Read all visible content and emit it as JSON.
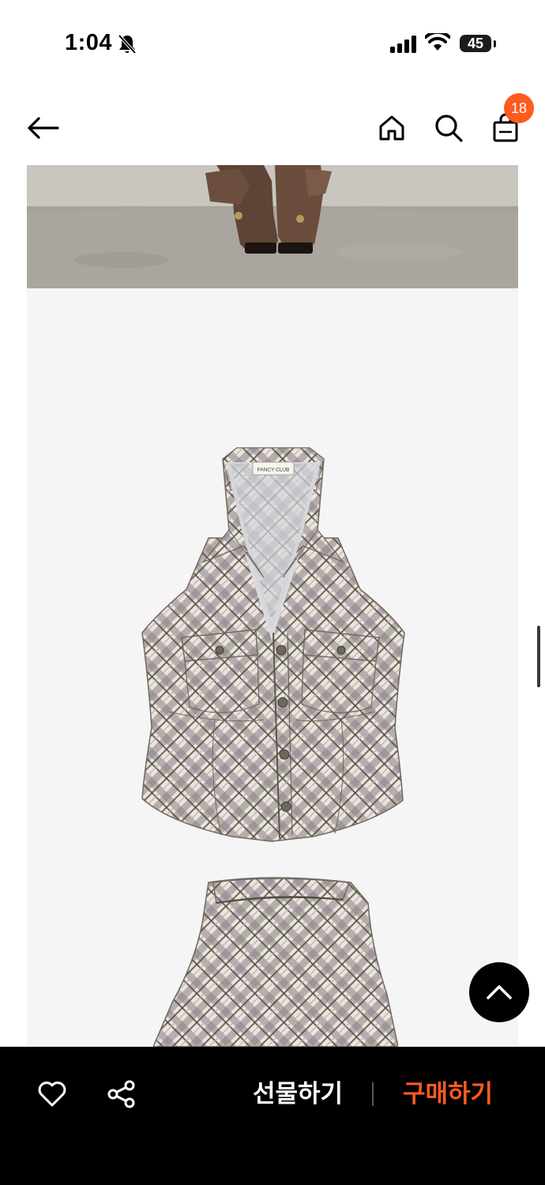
{
  "status_bar": {
    "time": "1:04",
    "battery": "45",
    "icons": [
      "bell-slash-icon",
      "cellular-signal-icon",
      "wifi-icon",
      "battery-icon"
    ]
  },
  "nav": {
    "icons": [
      "back-arrow-icon",
      "home-icon",
      "search-icon",
      "shopping-bag-icon"
    ],
    "cart_count": "18"
  },
  "product": {
    "label_text": "FANCY CLUB"
  },
  "bottom_bar": {
    "gift_label": "선물하기",
    "buy_label": "구매하기",
    "icons": [
      "heart-icon",
      "share-icon"
    ]
  },
  "colors": {
    "accent": "#ff5a1f",
    "bottom_bar_bg": "#000000",
    "content_bg": "#f5f5f6"
  }
}
